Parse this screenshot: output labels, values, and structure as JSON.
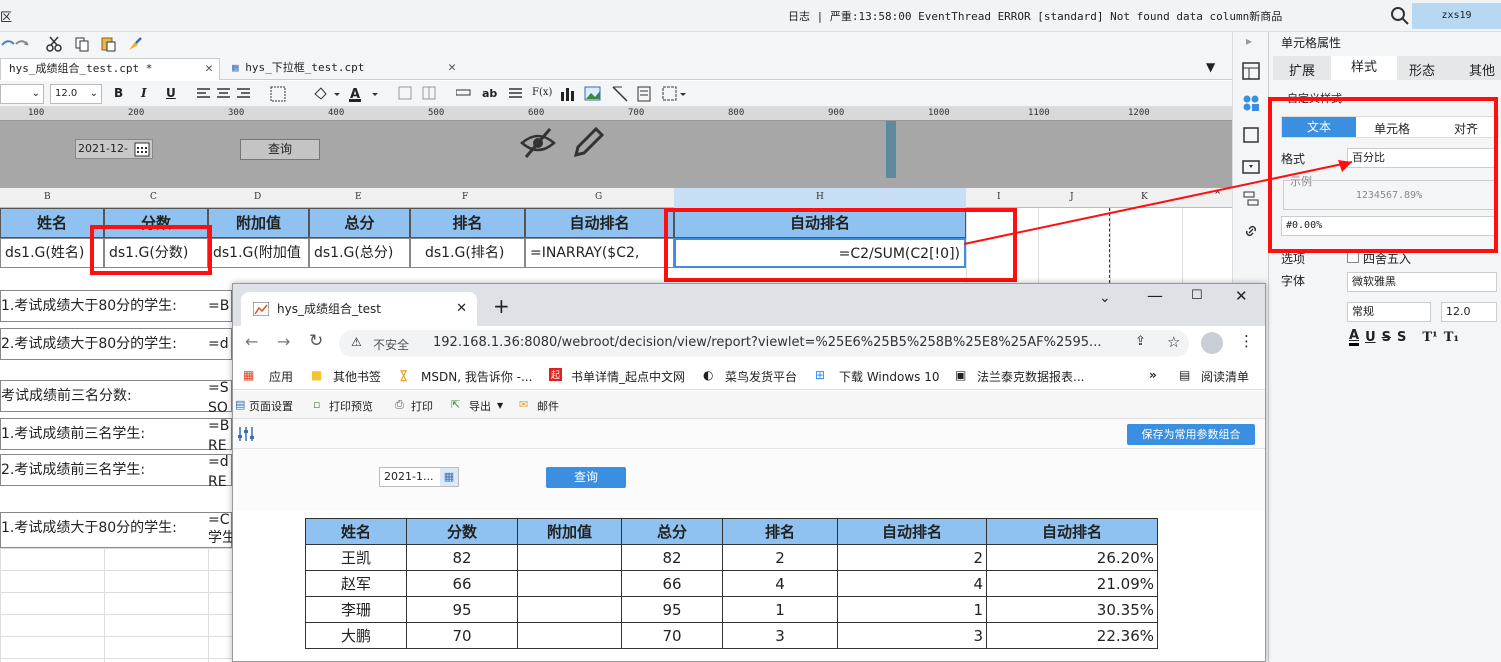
{
  "topbar": {
    "menu_char": "区",
    "log": "日志 | 严重:13:58:00 EventThread ERROR [standard] Not found data column新商品",
    "user": "zxs19"
  },
  "tabs": [
    {
      "label": "hys_成绩组合_test.cpt *"
    },
    {
      "label": "hys_下拉框_test.cpt"
    }
  ],
  "format_bar": {
    "font_size": "12.0",
    "bold": "B",
    "italic": "I",
    "underline": "U",
    "text_icon": "ab",
    "formula_icon": "F(x)"
  },
  "ruler": [
    "100",
    "200",
    "300",
    "400",
    "500",
    "600",
    "700",
    "800",
    "900",
    "1000",
    "1100",
    "1200"
  ],
  "param_area": {
    "date_value": "2021-12-",
    "query_label": "查询"
  },
  "col_headers": [
    "B",
    "C",
    "D",
    "E",
    "F",
    "G",
    "H",
    "I",
    "J",
    "K"
  ],
  "grid": {
    "headers": [
      "姓名",
      "分数",
      "附加值",
      "总分",
      "排名",
      "自动排名",
      "自动排名"
    ],
    "cells": [
      "ds1.G(姓名)",
      "ds1.G(分数)",
      "ds1.G(附加值",
      "ds1.G(总分)",
      "ds1.G(排名)",
      "=INARRAY($C2,",
      "=C2/SUM(C2[!0])"
    ],
    "left_rows": [
      "1.考试成绩大于80分的学生:",
      "2.考试成绩大于80分的学生:",
      "考试成绩前三名分数:",
      "1.考试成绩前三名学生:",
      "2.考试成绩前三名学生:",
      "1.考试成绩大于80分的学生:"
    ],
    "formula_stubs": [
      "=B",
      "=d",
      "=S",
      "SO",
      "=B",
      "RE",
      "=d",
      "RE",
      "=C",
      "学生"
    ]
  },
  "right_panel": {
    "title": "单元格属性",
    "tabs": [
      "扩展",
      "样式",
      "形态",
      "其他"
    ],
    "custom_style": "自定义样式",
    "subtabs": [
      "文本",
      "单元格",
      "对齐"
    ],
    "format_label": "格式",
    "format_value": "百分比",
    "sample_label": "示例",
    "sample_value": "1234567.89%",
    "pattern": "#0.00%",
    "overflow_label": "选项",
    "round_label": "四舍五入",
    "font_label": "字体",
    "font_value": "微软雅黑",
    "font_style": "常规",
    "font_size": "12.0",
    "style_letters": [
      "A",
      "U",
      "S",
      "S",
      "T¹",
      "T₁"
    ]
  },
  "browser": {
    "tab_title": "hys_成绩组合_test",
    "insecure": "不安全",
    "url": "192.168.1.36:8080/webroot/decision/view/report?viewlet=%25E6%25B5%258B%25E8%25AF%2595...",
    "bookmarks": [
      "应用",
      "其他书签",
      "MSDN, 我告诉你 -...",
      "书单详情_起点中文网",
      "菜鸟发货平台",
      "下载 Windows 10",
      "法兰泰克数据报表...",
      "阅读清单"
    ],
    "report_tools": [
      "页面设置",
      "打印预览",
      "打印",
      "导出",
      "邮件"
    ],
    "save_combo": "保存为常用参数组合",
    "date_value": "2021-1...",
    "query_label": "查询",
    "table": {
      "headers": [
        "姓名",
        "分数",
        "附加值",
        "总分",
        "排名",
        "自动排名",
        "自动排名"
      ],
      "rows": [
        [
          "王凯",
          "82",
          "",
          "82",
          "2",
          "2",
          "26.20%"
        ],
        [
          "赵军",
          "66",
          "",
          "66",
          "4",
          "4",
          "21.09%"
        ],
        [
          "李珊",
          "95",
          "",
          "95",
          "1",
          "1",
          "30.35%"
        ],
        [
          "大鹏",
          "70",
          "",
          "70",
          "3",
          "3",
          "22.36%"
        ]
      ]
    }
  },
  "colors": {
    "header_blue": "#8fc2f0",
    "highlight_red": "#ff1010",
    "tab_blue": "#3b8fe0"
  }
}
